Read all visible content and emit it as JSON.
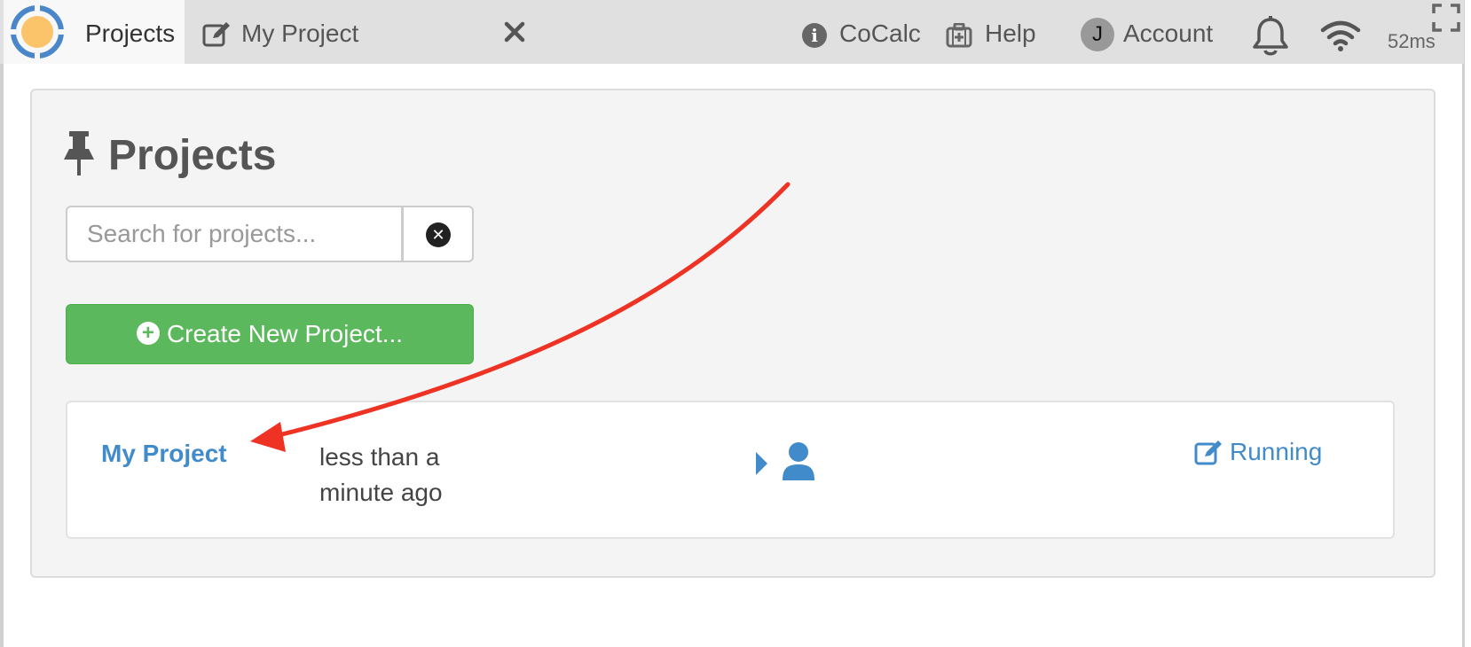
{
  "topbar": {
    "tabs": [
      {
        "label": "Projects"
      },
      {
        "label": "My Project"
      }
    ],
    "nav": {
      "about_label": "CoCalc",
      "help_label": "Help",
      "account_label": "Account",
      "avatar_initial": "J",
      "latency": "52ms"
    }
  },
  "main": {
    "title": "Projects",
    "search": {
      "placeholder": "Search for projects...",
      "value": ""
    },
    "create_button_label": "Create New Project...",
    "projects": [
      {
        "title": "My Project",
        "last_edited": "less than a minute ago",
        "status": "Running"
      }
    ]
  },
  "icons": {
    "logo": "cocalc-logo-icon",
    "edit": "edit-icon",
    "close": "close-icon",
    "info": "info-icon",
    "help": "medkit-icon",
    "notifications": "bell-icon",
    "connection": "wifi-icon",
    "fullscreen": "fullscreen-icon",
    "pin": "pin-icon",
    "clear": "times-circle-icon",
    "create": "plus-circle-icon",
    "collaborators": "user-icon"
  },
  "colors": {
    "link": "#428bca",
    "success": "#5cb85c",
    "logo_ring": "#4a86c8",
    "logo_center": "#fbc46a",
    "annotation_arrow": "#ee3224"
  }
}
